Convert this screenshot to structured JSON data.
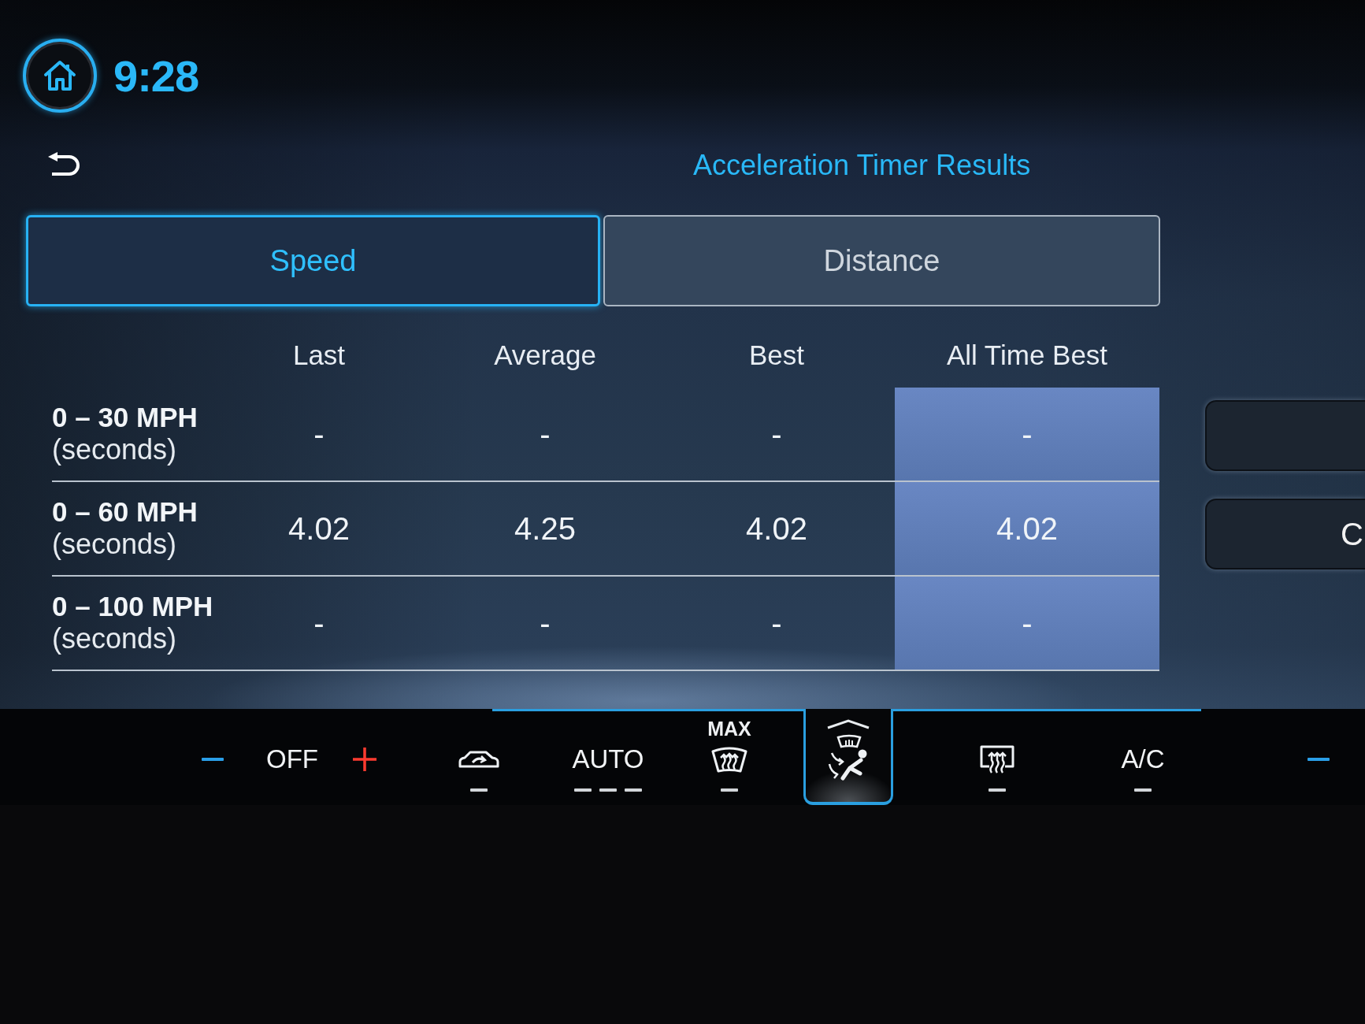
{
  "status_bar": {
    "time": "9:28"
  },
  "page": {
    "title": "Acceleration Timer Results"
  },
  "tabs": [
    {
      "label": "Speed",
      "selected": true
    },
    {
      "label": "Distance",
      "selected": false
    }
  ],
  "table": {
    "columns": [
      {
        "label": "Last",
        "highlighted": false
      },
      {
        "label": "Average",
        "highlighted": false
      },
      {
        "label": "Best",
        "highlighted": false
      },
      {
        "label": "All Time Best",
        "highlighted": true
      }
    ],
    "rows": [
      {
        "label": "0 – 30 MPH",
        "unit": "(seconds)",
        "cells": [
          "-",
          "-",
          "-",
          "-"
        ]
      },
      {
        "label": "0 – 60 MPH",
        "unit": "(seconds)",
        "cells": [
          "4.02",
          "4.25",
          "4.02",
          "4.02"
        ]
      },
      {
        "label": "0 – 100 MPH",
        "unit": "(seconds)",
        "cells": [
          "-",
          "-",
          "-",
          "-"
        ]
      }
    ]
  },
  "side_buttons": [
    {
      "kind": "blank"
    },
    {
      "kind": "text",
      "label": "C"
    }
  ],
  "climate": {
    "controls": [
      {
        "kind": "temp_down"
      },
      {
        "kind": "temperature",
        "label": "OFF"
      },
      {
        "kind": "temp_up"
      },
      {
        "kind": "recirculation",
        "on": false
      },
      {
        "kind": "auto",
        "label": "AUTO",
        "on": false
      },
      {
        "kind": "max_defrost",
        "label": "MAX",
        "on": false
      },
      {
        "kind": "airflow"
      },
      {
        "kind": "rear_defrost",
        "on": false
      },
      {
        "kind": "ac",
        "label": "A/C",
        "on": false
      },
      {
        "kind": "temp_down"
      }
    ]
  }
}
